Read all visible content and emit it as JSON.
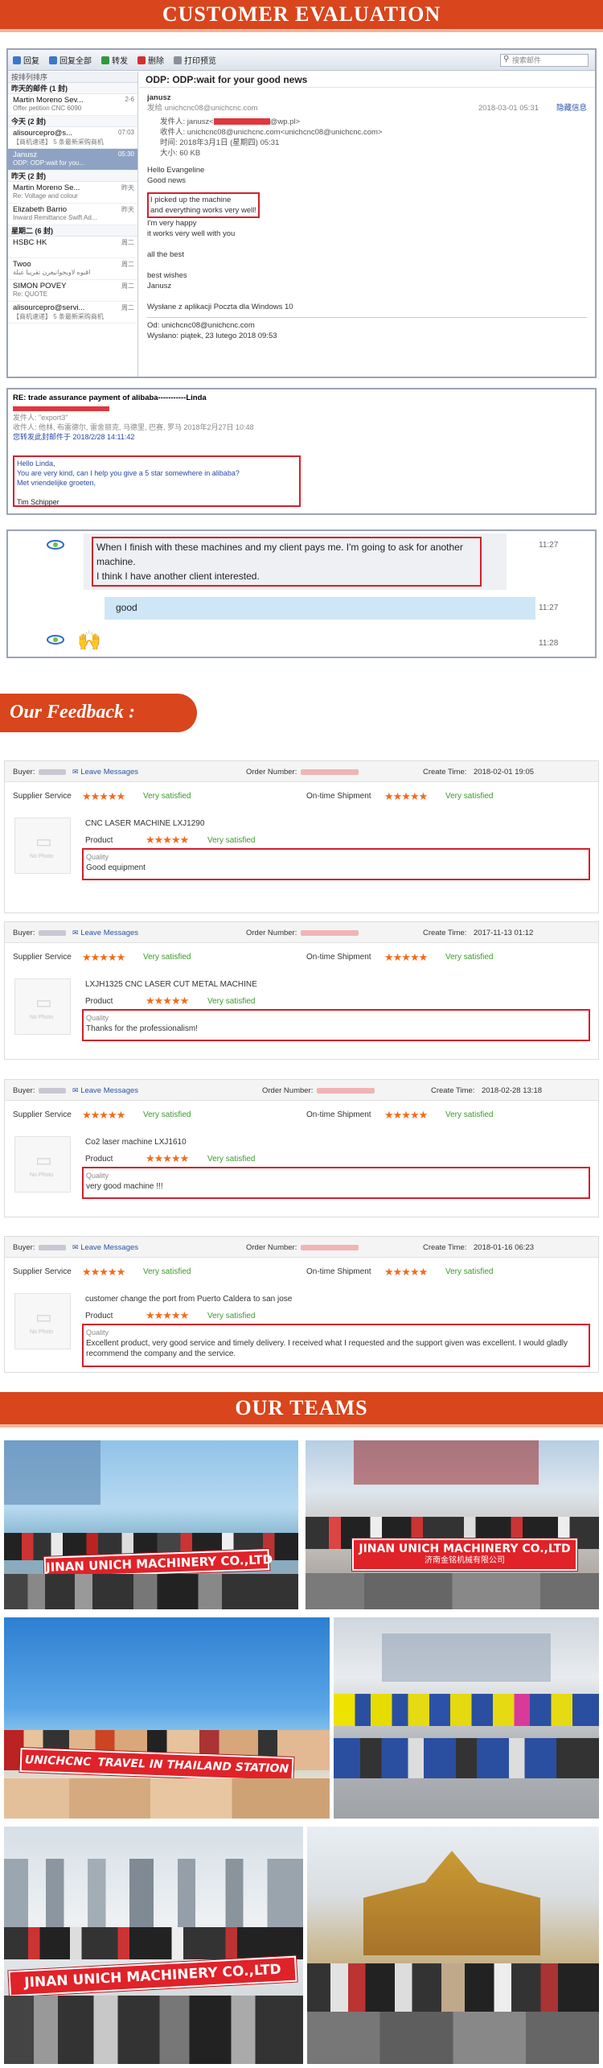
{
  "sections": {
    "evaluation_title": "CUSTOMER EVALUATION",
    "feedback_title": "Our Feedback :",
    "teams_title": "OUR TEAMS"
  },
  "email1": {
    "toolbar": [
      "回复",
      "回复全部",
      "转发",
      "删除",
      "打印预览"
    ],
    "search_placeholder": "搜索邮件",
    "list_header": "按排列排序",
    "groups": [
      {
        "label": "昨天的邮件 (1 封)",
        "items": [
          {
            "from": "Martin Moreno Sev...",
            "subject": "Offer petition CNC 6090",
            "time": "2-6"
          }
        ]
      },
      {
        "label": "今天 (2 封)",
        "items": [
          {
            "from": "alisourcepro@s...",
            "subject": "【商机速递】 5 条最新采购商机",
            "time": "07:03"
          },
          {
            "from": "Janusz",
            "subject": "ODP: ODP:wait for you...",
            "time": "05:30",
            "selected": true
          }
        ]
      },
      {
        "label": "昨天 (2 封)",
        "items": [
          {
            "from": "Martin Moreno Se...",
            "subject": "Re: Voltage and colour",
            "time": "昨天"
          },
          {
            "from": "Elizabeth Barrio",
            "subject": "Inward Remittance Swift Ad...",
            "time": "昨天"
          }
        ]
      },
      {
        "label": "星期二 (6 封)",
        "items": [
          {
            "from": "HSBC HK",
            "subject": "",
            "time": "周二"
          },
          {
            "from": "Twoo",
            "subject": "اقبوه لاويخوانيغرن تقريبا عبلة",
            "time": "周二"
          },
          {
            "from": "SIMON POVEY",
            "subject": "Re: QUOTE",
            "time": "周二"
          },
          {
            "from": "alisourcepro@servi...",
            "subject": "【商机速递】 5 条最新采购商机",
            "time": "周二"
          }
        ]
      }
    ],
    "subject": "ODP: ODP:wait for your good news",
    "sender_name": "janusz",
    "sender_line": "发给 unichcnc08@unichcnc.com",
    "date": "2018-03-01 05:31",
    "hide_details": "隐藏信息",
    "from_label": "发件人: janusz<",
    "from_suffix": "@wp.pl>",
    "to_label": "收件人: unichcnc08@unichcnc.com<unichcnc08@unichcnc.com>",
    "time_label": "时间: 2018年3月1日 (星期四) 05:31",
    "size_label": "大小: 60 KB",
    "body": [
      "Hello Evangeline",
      "Good news"
    ],
    "highlight": [
      "I picked up the machine",
      "and everything works very well!"
    ],
    "body2": [
      "I'm very happy",
      "it works very well with you",
      "",
      "all the best",
      "",
      "best wishes",
      "Janusz",
      "",
      "Wysłane z aplikacji Poczta dla Windows 10"
    ],
    "footer_from": "Od: unichcnc08@unichcnc.com",
    "footer_sent": "Wysłano: piątek, 23 lutego 2018 09:53"
  },
  "email2": {
    "subject": "RE: trade assurance payment of alibaba-----------Linda",
    "meta1": "发件人: \"export3\"",
    "meta2": "时间: 2018年2月27日 (星期二) 10:48",
    "meta3": "收件人: 他林, 布雷德尔, 雷舍丽克, 马德里, 巴赛, 罗马 2018年2月27日 10:48",
    "attach": "您转发此封邮件于 2018/2/28 14:11:42",
    "highlight": [
      "Hello Linda,",
      "You are very kind, can I help you give a 5 star somewhere in alibaba?",
      "Met vriendelijke groeten,",
      "",
      "Tim Schipper"
    ]
  },
  "chat": {
    "messages": [
      {
        "text": "When I finish with these machines and my client pays me. I'm going to ask for another machine.",
        "text2": "I think I have another client interested.",
        "time": "11:27"
      },
      {
        "text": "good",
        "time": "11:27"
      },
      {
        "text": "🙌",
        "time": "11:28"
      }
    ]
  },
  "feedback": [
    {
      "buyer": "Buyer:",
      "leave": "Leave Messages",
      "order_label": "Order Number:",
      "create_label": "Create Time:",
      "create_time": "2018-02-01 19:05",
      "supplier_service": "Supplier Service",
      "on_time": "On-time Shipment",
      "satisfied": "Very satisfied",
      "product_title": "CNC LASER MACHINE LXJ1290",
      "product_label": "Product",
      "quality_label": "Quality",
      "quality_text": "Good equipment"
    },
    {
      "buyer": "Buyer:",
      "leave": "Leave Messages",
      "order_label": "Order Number:",
      "create_label": "Create Time:",
      "create_time": "2017-11-13 01:12",
      "supplier_service": "Supplier Service",
      "on_time": "On-time Shipment",
      "satisfied": "Very satisfied",
      "product_title": "LXJH1325 CNC LASER CUT METAL MACHINE",
      "product_label": "Product",
      "quality_label": "Quality",
      "quality_text": "Thanks for the professionalism!"
    },
    {
      "buyer": "Buyer:",
      "leave": "Leave Messages",
      "order_label": "Order Number:",
      "create_label": "Create Time:",
      "create_time": "2018-02-28 13:18",
      "supplier_service": "Supplier Service",
      "on_time": "On-time Shipment",
      "satisfied": "Very satisfied",
      "product_title": "Co2 laser machine LXJ1610",
      "product_label": "Product",
      "quality_label": "Quality",
      "quality_text": "very good machine !!!"
    },
    {
      "buyer": "Buyer:",
      "leave": "Leave Messages",
      "order_label": "Order Number:",
      "create_label": "Create Time:",
      "create_time": "2018-01-16 06:23",
      "supplier_service": "Supplier Service",
      "on_time": "On-time Shipment",
      "satisfied": "Very satisfied",
      "product_title": "customer change the port from Puerto Caldera to san jose",
      "product_label": "Product",
      "quality_label": "Quality",
      "quality_text": "Excellent product, very good service and timely delivery. I received what I requested and the support given was excellent. I would gladly recommend the company and the service."
    }
  ],
  "no_photo": "No Photo",
  "stars": "★★★★★",
  "teams": {
    "photo1_banner": "JINAN UNICH MACHINERY CO.,LTD",
    "photo2_banner": "JINAN UNICH MACHINERY CO.,LTD",
    "photo2_sub": "济南金铭机械有限公司",
    "photo3_logo": "UNICHCNC",
    "photo3_banner": "TRAVEL IN THAILAND STATION",
    "photo5_banner": "JINAN UNICH MACHINERY CO.,LTD"
  },
  "colors": {
    "accent": "#d9451c",
    "highlight": "#d3202c",
    "star": "#f26b1d",
    "satisfied": "#3a9a2a"
  }
}
